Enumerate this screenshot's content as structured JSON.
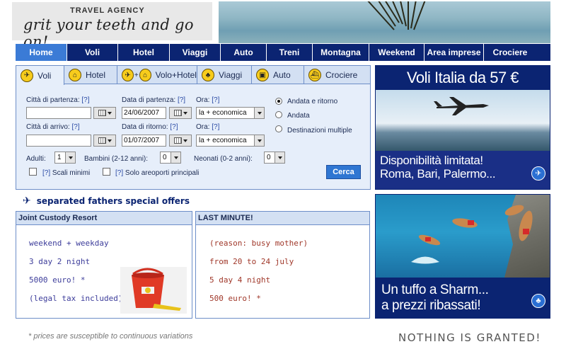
{
  "header": {
    "agency": "TRAVEL AGENCY",
    "slogan": "grit your teeth and go on!"
  },
  "nav": {
    "items": [
      "Home",
      "Voli",
      "Hotel",
      "Viaggi",
      "Auto",
      "Treni",
      "Montagna",
      "Weekend",
      "Area imprese",
      "Crociere"
    ],
    "active": "Home"
  },
  "search": {
    "tabs": [
      {
        "label": "Voli",
        "icon": "plane-icon"
      },
      {
        "label": "Hotel",
        "icon": "house-icon"
      },
      {
        "label": "Volo+Hotel",
        "icon": "plane-house-icon"
      },
      {
        "label": "Viaggi",
        "icon": "palm-icon"
      },
      {
        "label": "Auto",
        "icon": "car-icon"
      },
      {
        "label": "Crociere",
        "icon": "ship-icon"
      }
    ],
    "departure_city_label": "Città di partenza:",
    "arrival_city_label": "Città di arrivo:",
    "departure_date_label": "Data di partenza:",
    "return_date_label": "Data di ritorno:",
    "time_label": "Ora:",
    "help": "[?]",
    "departure_date": "24/06/2007",
    "return_date": "01/07/2007",
    "time_value": "la + economica",
    "trip_types": [
      "Andata e ritorno",
      "Andata",
      "Destinazioni multiple"
    ],
    "adults_label": "Adulti:",
    "adults_value": "1",
    "children_label": "Bambini (2-12 anni):",
    "children_value": "0",
    "infants_label": "Neonati (0-2 anni):",
    "infants_value": "0",
    "min_stops_label": "Scali minimi",
    "main_airports_label": "Solo areoporti principali",
    "search_button": "Cerca"
  },
  "ads": {
    "ad1_title": "Voli Italia da 57 €",
    "ad1_line1": "Disponibilità limitata!",
    "ad1_line2": "Roma, Bari, Palermo...",
    "ad2_line1": "Un tuffo a Sharm...",
    "ad2_line2": "a prezzi ribassati!"
  },
  "offers": {
    "heading": "separated fathers special offers",
    "box1": {
      "title": "Joint Custody Resort",
      "lines": [
        "weekend + weekday",
        "3 day 2 night",
        "5000 euro! *",
        "(legal tax included)"
      ]
    },
    "box2": {
      "title": "LAST MINUTE!",
      "lines": [
        "(reason: busy mother)",
        "from 20 to 24 july",
        "5 day 4 night",
        "500 euro! *"
      ]
    }
  },
  "footer": {
    "note": "* prices are susceptible to continuous variations",
    "tagline": "NOTHING IS GRANTED!"
  }
}
